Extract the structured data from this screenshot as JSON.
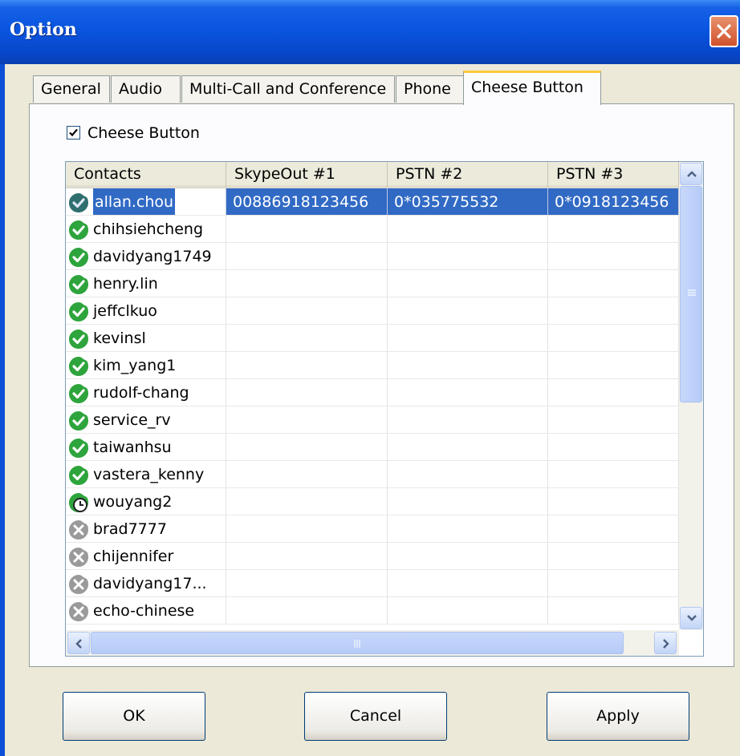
{
  "window": {
    "title": "Option"
  },
  "tabs": [
    {
      "label": "General",
      "active": false
    },
    {
      "label": "Audio",
      "active": false
    },
    {
      "label": "Multi-Call and Conference",
      "active": false
    },
    {
      "label": "Phone",
      "active": false
    },
    {
      "label": "Cheese Button",
      "active": true
    }
  ],
  "cheese_checkbox": {
    "label": "Cheese Button",
    "checked": true
  },
  "contacts_table": {
    "columns": [
      "Contacts",
      "SkypeOut #1",
      "PSTN #2",
      "PSTN #3"
    ],
    "rows": [
      {
        "name": "allan.chou",
        "status": "online",
        "skypeout1": "00886918123456",
        "pstn2": "0*035775532",
        "pstn3": "0*0918123456",
        "selected": true
      },
      {
        "name": "chihsiehcheng",
        "status": "online",
        "skypeout1": "",
        "pstn2": "",
        "pstn3": ""
      },
      {
        "name": "davidyang1749",
        "status": "online",
        "skypeout1": "",
        "pstn2": "",
        "pstn3": ""
      },
      {
        "name": "henry.lin",
        "status": "online",
        "skypeout1": "",
        "pstn2": "",
        "pstn3": ""
      },
      {
        "name": "jeffclkuo",
        "status": "online",
        "skypeout1": "",
        "pstn2": "",
        "pstn3": ""
      },
      {
        "name": "kevinsl",
        "status": "online",
        "skypeout1": "",
        "pstn2": "",
        "pstn3": ""
      },
      {
        "name": "kim_yang1",
        "status": "online",
        "skypeout1": "",
        "pstn2": "",
        "pstn3": ""
      },
      {
        "name": "rudolf-chang",
        "status": "online",
        "skypeout1": "",
        "pstn2": "",
        "pstn3": ""
      },
      {
        "name": "service_rv",
        "status": "online",
        "skypeout1": "",
        "pstn2": "",
        "pstn3": ""
      },
      {
        "name": "taiwanhsu",
        "status": "online",
        "skypeout1": "",
        "pstn2": "",
        "pstn3": ""
      },
      {
        "name": "vastera_kenny",
        "status": "online",
        "skypeout1": "",
        "pstn2": "",
        "pstn3": ""
      },
      {
        "name": "wouyang2",
        "status": "away",
        "skypeout1": "",
        "pstn2": "",
        "pstn3": ""
      },
      {
        "name": "brad7777",
        "status": "offline",
        "skypeout1": "",
        "pstn2": "",
        "pstn3": ""
      },
      {
        "name": "chijennifer",
        "status": "offline",
        "skypeout1": "",
        "pstn2": "",
        "pstn3": ""
      },
      {
        "name": "davidyang17...",
        "status": "offline",
        "skypeout1": "",
        "pstn2": "",
        "pstn3": ""
      },
      {
        "name": "echo-chinese",
        "status": "offline",
        "skypeout1": "",
        "pstn2": "",
        "pstn3": ""
      }
    ]
  },
  "buttons": {
    "ok": "OK",
    "cancel": "Cancel",
    "apply": "Apply"
  },
  "status_icons": {
    "online": "green-check-status-icon",
    "away": "clock-status-icon",
    "offline": "gray-x-status-icon"
  },
  "colors": {
    "title_bar": "#0a55e0",
    "selection": "#316ac5",
    "dialog_bg": "#ece9d8",
    "online": "#2ea43c",
    "offline": "#9a9a9a"
  }
}
